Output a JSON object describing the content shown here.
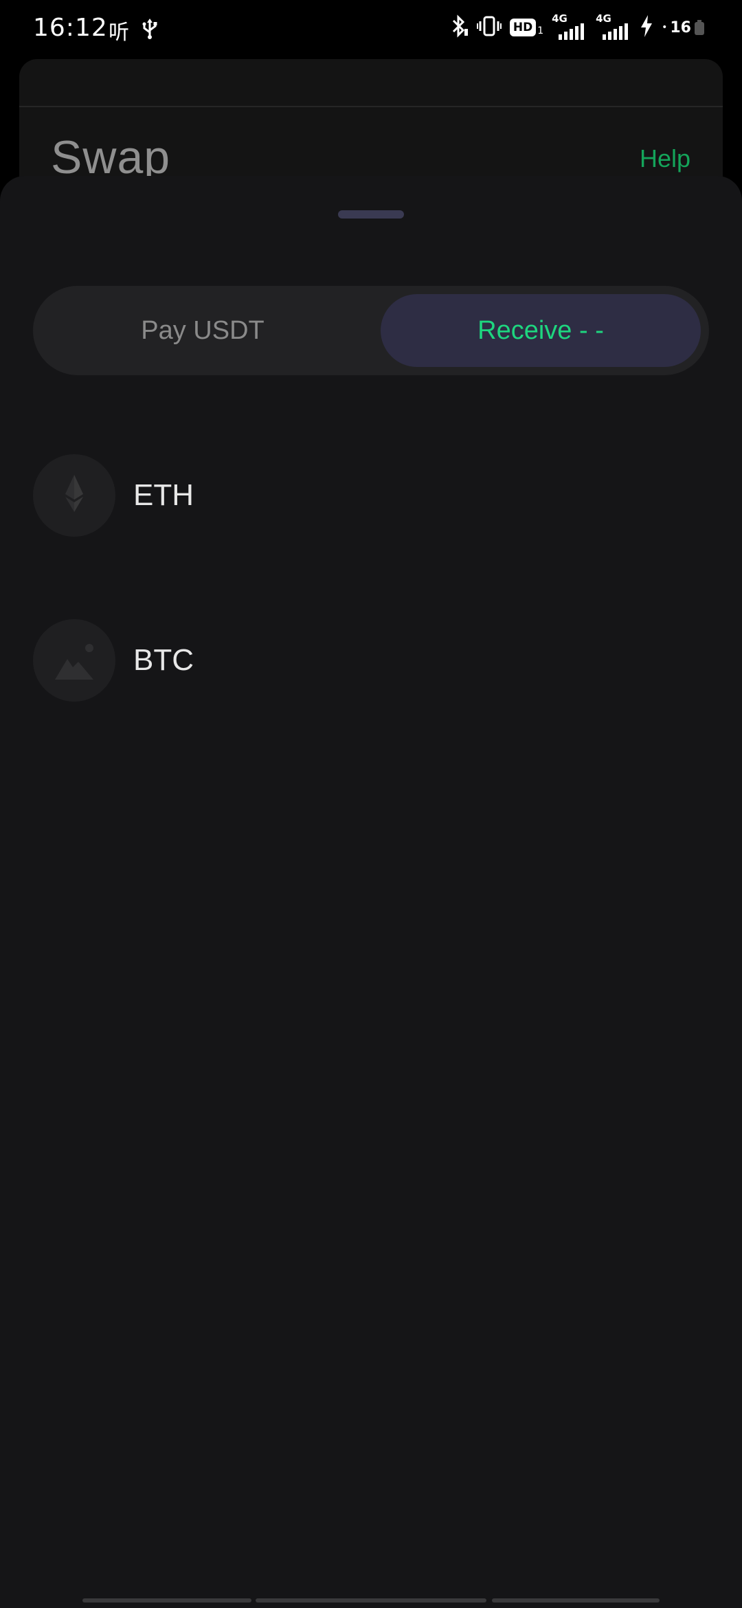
{
  "status_bar": {
    "time": "16:12",
    "listen_label": "听",
    "hd_label": "HD",
    "hd_sub": "1",
    "network_1": "4G",
    "network_2": "4G",
    "battery": "16"
  },
  "background_page": {
    "title": "Swap",
    "help_label": "Help"
  },
  "sheet": {
    "tabs": [
      {
        "label": "Pay USDT",
        "selected": false
      },
      {
        "label": "Receive - -",
        "selected": true
      }
    ],
    "assets": [
      {
        "label": "ETH",
        "icon": "ethereum-icon"
      },
      {
        "label": "BTC",
        "icon": "placeholder-image-icon"
      }
    ]
  },
  "colors": {
    "accent_green": "#1ed67f",
    "help_green": "#14a45a",
    "selected_tab_bg": "#2e2d44",
    "sheet_bg": "#151517"
  }
}
